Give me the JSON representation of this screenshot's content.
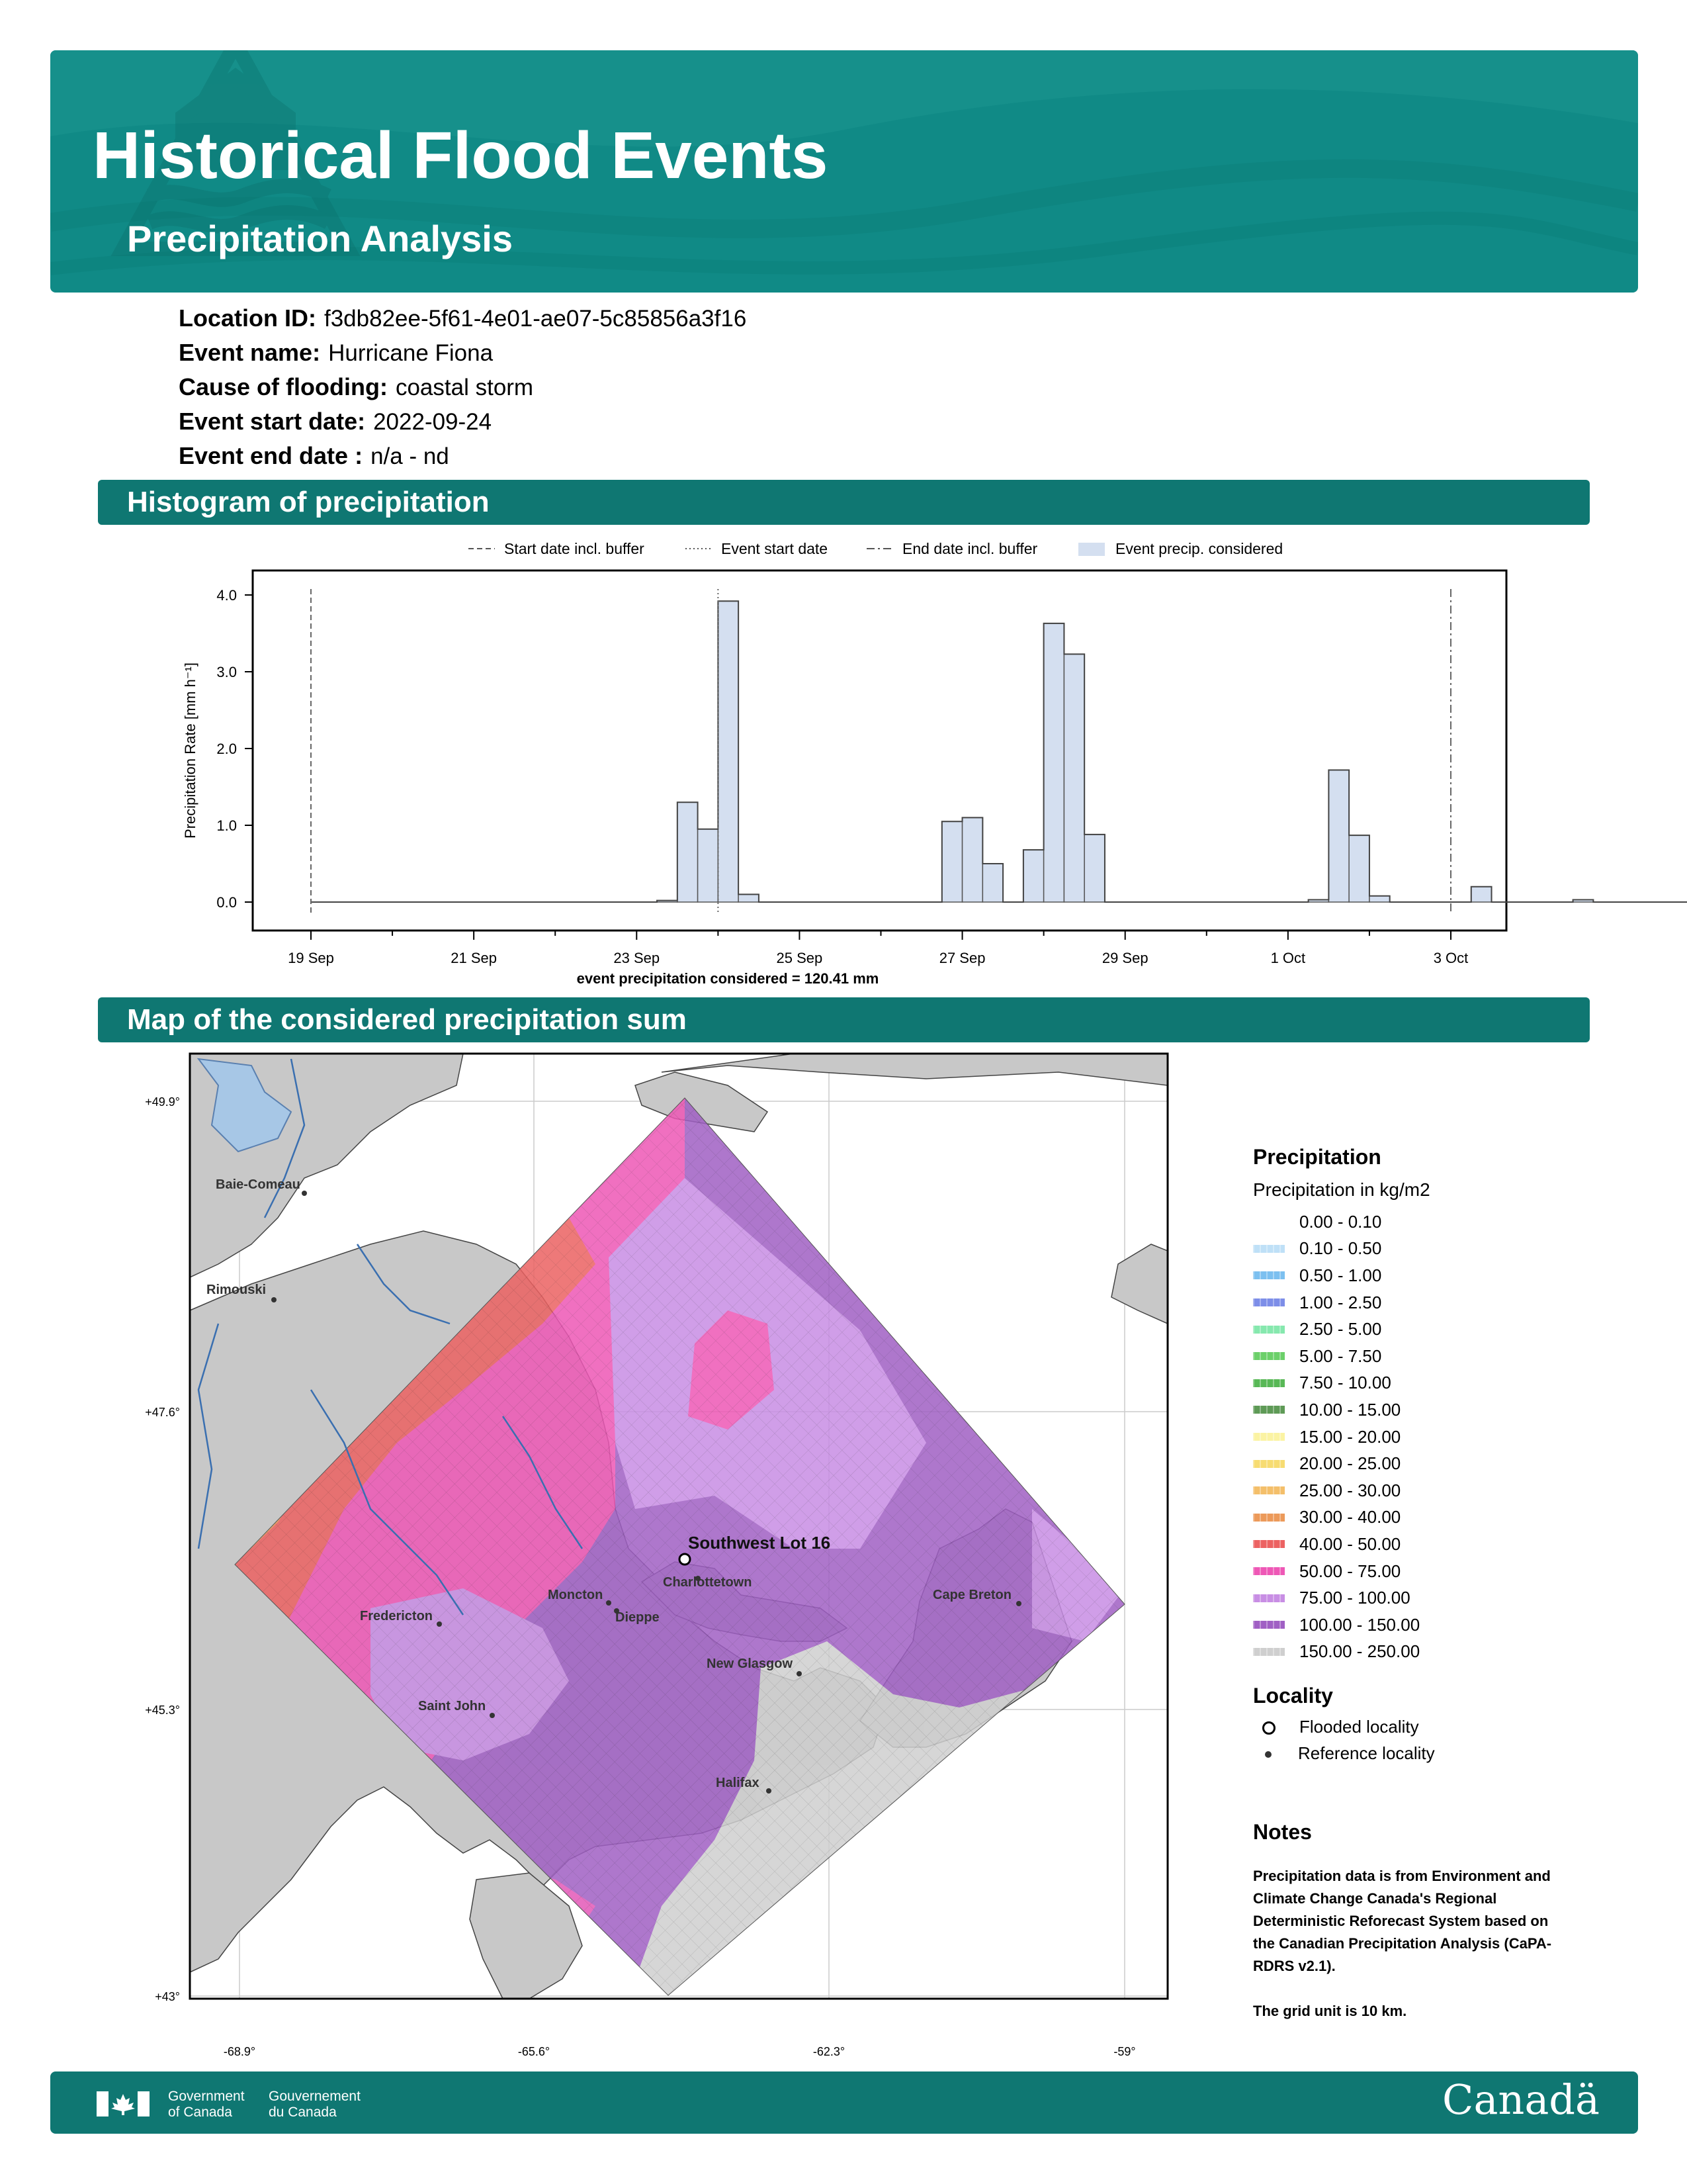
{
  "header": {
    "title": "Historical Flood Events",
    "subtitle": "Precipitation Analysis"
  },
  "info": {
    "location_id_label": "Location ID:",
    "location_id": "f3db82ee-5f61-4e01-ae07-5c85856a3f16",
    "event_name_label": "Event name:",
    "event_name": "Hurricane Fiona",
    "cause_label": "Cause of flooding:",
    "cause": "coastal storm",
    "start_label": "Event start date:",
    "start": "2022-09-24",
    "end_label": "Event end date :",
    "end": "n/a - nd"
  },
  "sections": {
    "histogram": "Histogram of precipitation",
    "map": "Map of the considered precipitation sum"
  },
  "chart_data": {
    "type": "bar",
    "ylabel": "Precipitation Rate [mm h⁻¹]",
    "ylim": [
      -0.4,
      4.3
    ],
    "yticks": [
      "0.0",
      "1.0",
      "2.0",
      "3.0",
      "4.0"
    ],
    "xtick_labels": [
      "19 Sep",
      "21 Sep",
      "23 Sep",
      "25 Sep",
      "27 Sep",
      "29 Sep",
      "1 Oct",
      "3 Oct"
    ],
    "bin_hours": 6,
    "start_label": "2022-09-19 00:00",
    "values": [
      0,
      0,
      0,
      0,
      0,
      0,
      0,
      0,
      0,
      0,
      0,
      0,
      0,
      0,
      0,
      0,
      0,
      0.02,
      1.3,
      0.95,
      3.92,
      0.1,
      0,
      0,
      0,
      0,
      0,
      0,
      0,
      0,
      0,
      1.05,
      1.1,
      0.5,
      0,
      0.68,
      3.63,
      3.23,
      0.88,
      0,
      0,
      0,
      0,
      0,
      0,
      0,
      0,
      0,
      0,
      0.03,
      1.72,
      0.87,
      0.08,
      0,
      0,
      0,
      0,
      0.2,
      0,
      0,
      0,
      0,
      0.03,
      0,
      0,
      0,
      0,
      0,
      0,
      0,
      0,
      0,
      0,
      0,
      0,
      0,
      0,
      0.01,
      0,
      0,
      0,
      0,
      0,
      0,
      0.01,
      0,
      0,
      0,
      0,
      0,
      0,
      0,
      0,
      0,
      0,
      0,
      0,
      0,
      0,
      0,
      0,
      0,
      0,
      0,
      0,
      0,
      0,
      0,
      0,
      0,
      0,
      0,
      0,
      0,
      0,
      0,
      0,
      0,
      0,
      0,
      0,
      0,
      0,
      0,
      0,
      0,
      0,
      0,
      0,
      0,
      0,
      0,
      0,
      0,
      0,
      0,
      0,
      0,
      0,
      0,
      0,
      0,
      0,
      0,
      0,
      0,
      0,
      0
    ],
    "legend": [
      {
        "label": "Start date incl. buffer",
        "style": "dashed"
      },
      {
        "label": "Event start date",
        "style": "dotted"
      },
      {
        "label": "End date incl. buffer",
        "style": "dashdot"
      },
      {
        "label": "Event precip. considered",
        "style": "patch"
      }
    ],
    "vlines": {
      "start_buffer": "19 Sep",
      "event_start": "24 Sep",
      "end_buffer": "3 Oct"
    },
    "annotation": "event precipitation considered = 120.41 mm",
    "colors": {
      "bar": "#d4dff0",
      "edge": "#555555"
    },
    "grid": false
  },
  "map": {
    "lat_labels": [
      "+49.9°",
      "+47.6°",
      "+45.3°",
      "+43°"
    ],
    "lon_labels": [
      "-68.9°",
      "-65.6°",
      "-62.3°",
      "-59°"
    ],
    "places": [
      {
        "name": "Baie-Comeau"
      },
      {
        "name": "Rimouski"
      },
      {
        "name": "Fredericton"
      },
      {
        "name": "Saint John"
      },
      {
        "name": "Moncton"
      },
      {
        "name": "Dieppe"
      },
      {
        "name": "Charlottetown"
      },
      {
        "name": "New Glasgow"
      },
      {
        "name": "Halifax"
      },
      {
        "name": "Cape Breton"
      }
    ],
    "flooded_locality": "Southwest Lot 16"
  },
  "legend": {
    "title": "Precipitation",
    "subtitle": "Precipitation in kg/m2",
    "items": [
      {
        "label": "0.00 - 0.10",
        "color": "#ffffff"
      },
      {
        "label": "0.10 - 0.50",
        "color": "#bfe0f7"
      },
      {
        "label": "0.50 - 1.00",
        "color": "#7cc0f0"
      },
      {
        "label": "1.00 - 2.50",
        "color": "#7d8ee8"
      },
      {
        "label": "2.50 - 5.00",
        "color": "#86e8ae"
      },
      {
        "label": "5.00 - 7.50",
        "color": "#6cd06a"
      },
      {
        "label": "7.50 - 10.00",
        "color": "#58b856"
      },
      {
        "label": "10.00 - 15.00",
        "color": "#5e9a56"
      },
      {
        "label": "15.00 - 20.00",
        "color": "#fbf3a3"
      },
      {
        "label": "20.00 - 25.00",
        "color": "#f7dc72"
      },
      {
        "label": "25.00 - 30.00",
        "color": "#f4bf6a"
      },
      {
        "label": "30.00 - 40.00",
        "color": "#ec9a5a"
      },
      {
        "label": "40.00 - 50.00",
        "color": "#ec6262"
      },
      {
        "label": "50.00 - 75.00",
        "color": "#ee58b6"
      },
      {
        "label": "75.00 - 100.00",
        "color": "#c88ee4"
      },
      {
        "label": "100.00 - 150.00",
        "color": "#a060c4"
      },
      {
        "label": "150.00 - 250.00",
        "color": "#cfcfcf"
      }
    ],
    "locality_title": "Locality",
    "flooded": "Flooded locality",
    "reference": "Reference locality"
  },
  "notes": {
    "title": "Notes",
    "lines": [
      "Precipitation data is from Environment and",
      "Climate Change Canada's Regional",
      "Deterministic Reforecast System based on",
      "the Canadian Precipitation Analysis (CaPA-",
      "RDRS v2.1)."
    ],
    "grid_note": "The grid unit is 10 km."
  },
  "footer": {
    "gov_en_1": "Government",
    "gov_en_2": "of Canada",
    "gov_fr_1": "Gouvernement",
    "gov_fr_2": "du Canada",
    "wordmark": "Canadä"
  }
}
